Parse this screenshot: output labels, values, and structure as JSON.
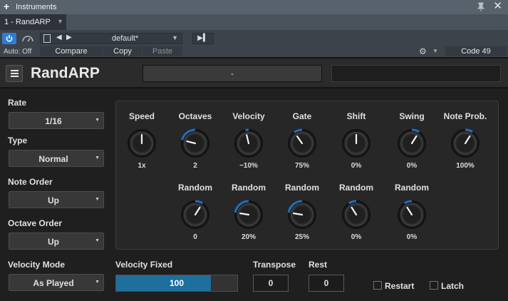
{
  "window": {
    "title": "Instruments"
  },
  "tab": {
    "label": "1 - RandARP"
  },
  "toolbar": {
    "auto_label": "Auto: Off",
    "preset_name": "default*",
    "compare_label": "Compare",
    "copy_label": "Copy",
    "paste_label": "Paste",
    "code_label": "Code 49"
  },
  "plugin": {
    "name": "RandARP",
    "display_value": "-"
  },
  "left": {
    "rate_label": "Rate",
    "rate_value": "1/16",
    "type_label": "Type",
    "type_value": "Normal",
    "note_order_label": "Note Order",
    "note_order_value": "Up",
    "octave_order_label": "Octave Order",
    "octave_order_value": "Up",
    "velocity_mode_label": "Velocity Mode",
    "velocity_mode_value": "As Played"
  },
  "knobs_top": [
    {
      "label": "Speed",
      "value": "1x",
      "level": 0.5
    },
    {
      "label": "Octaves",
      "value": "2",
      "level": 0.22
    },
    {
      "label": "Velocity",
      "value": "−10%",
      "level": 0.45
    },
    {
      "label": "Gate",
      "value": "75%",
      "level": 0.37
    },
    {
      "label": "Shift",
      "value": "0%",
      "level": 0.5
    },
    {
      "label": "Swing",
      "value": "0%",
      "level": 0.62
    },
    {
      "label": "Note Prob.",
      "value": "100%",
      "level": 0.62
    }
  ],
  "knobs_bottom": [
    {
      "label": "Random",
      "value": "0",
      "level": 0.62
    },
    {
      "label": "Random",
      "value": "20%",
      "level": 0.2
    },
    {
      "label": "Random",
      "value": "25%",
      "level": 0.2
    },
    {
      "label": "Random",
      "value": "0%",
      "level": 0.38
    },
    {
      "label": "Random",
      "value": "0%",
      "level": 0.38
    }
  ],
  "velocity_fixed": {
    "label": "Velocity Fixed",
    "value": "100",
    "level": 0.78
  },
  "transpose": {
    "label": "Transpose",
    "value": "0"
  },
  "rest": {
    "label": "Rest",
    "value": "0"
  },
  "restart_label": "Restart",
  "latch_label": "Latch",
  "colors": {
    "accent": "#2d7ed0",
    "knob_ring": "#1e6fc0",
    "slider_fill": "#1e6e9e"
  }
}
